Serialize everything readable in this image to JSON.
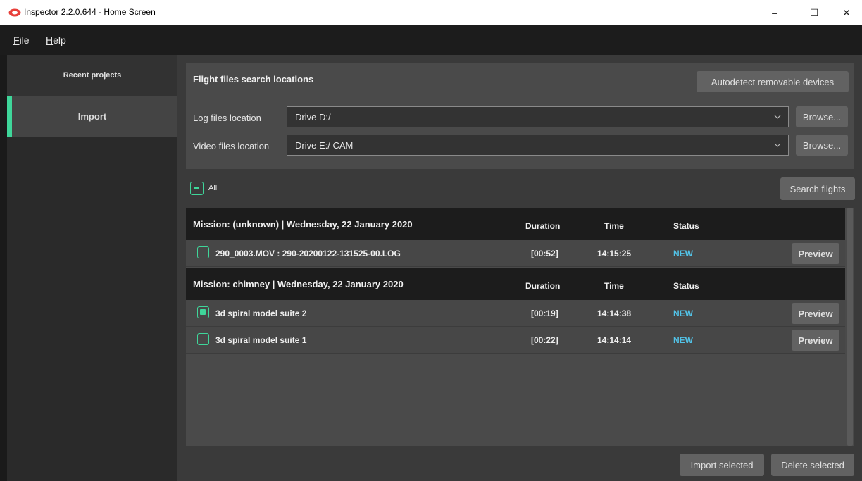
{
  "window": {
    "title": "Inspector 2.2.0.644 - Home Screen",
    "minimize_glyph": "–",
    "maximize_glyph": "☐",
    "close_glyph": "✕"
  },
  "menu": {
    "file_accel": "F",
    "file_rest": "ile",
    "help_accel": "H",
    "help_rest": "elp"
  },
  "sidebar": {
    "items": [
      {
        "label": "Recent projects"
      },
      {
        "label": "Import"
      }
    ]
  },
  "search": {
    "title": "Flight files search locations",
    "autodetect_label": "Autodetect removable devices",
    "log_label": "Log files location",
    "log_value": "Drive D:/",
    "video_label": "Video files location",
    "video_value": "Drive E:/ CAM",
    "browse_label": "Browse..."
  },
  "toolbar": {
    "all_label": "All",
    "search_flights_label": "Search flights"
  },
  "groups": [
    {
      "title": "Mission: (unknown) | Wednesday, 22 January 2020",
      "col_duration": "Duration",
      "col_time": "Time",
      "col_status": "Status",
      "rows": [
        {
          "name": "290_0003.MOV : 290-20200122-131525-00.LOG",
          "duration": "[00:52]",
          "time": "14:15:25",
          "status": "NEW",
          "checked": false,
          "preview": "Preview"
        }
      ]
    },
    {
      "title": "Mission: chimney | Wednesday, 22 January 2020",
      "col_duration": "Duration",
      "col_time": "Time",
      "col_status": "Status",
      "rows": [
        {
          "name": "3d spiral model suite 2",
          "duration": "[00:19]",
          "time": "14:14:38",
          "status": "NEW",
          "checked": true,
          "preview": "Preview"
        },
        {
          "name": "3d spiral model suite 1",
          "duration": "[00:22]",
          "time": "14:14:14",
          "status": "NEW",
          "checked": false,
          "preview": "Preview"
        }
      ]
    }
  ],
  "footer": {
    "import_label": "Import selected",
    "delete_label": "Delete selected"
  },
  "colors": {
    "accent": "#3fd69a",
    "status_new": "#52c3e8",
    "app_icon": "#e8403a"
  }
}
